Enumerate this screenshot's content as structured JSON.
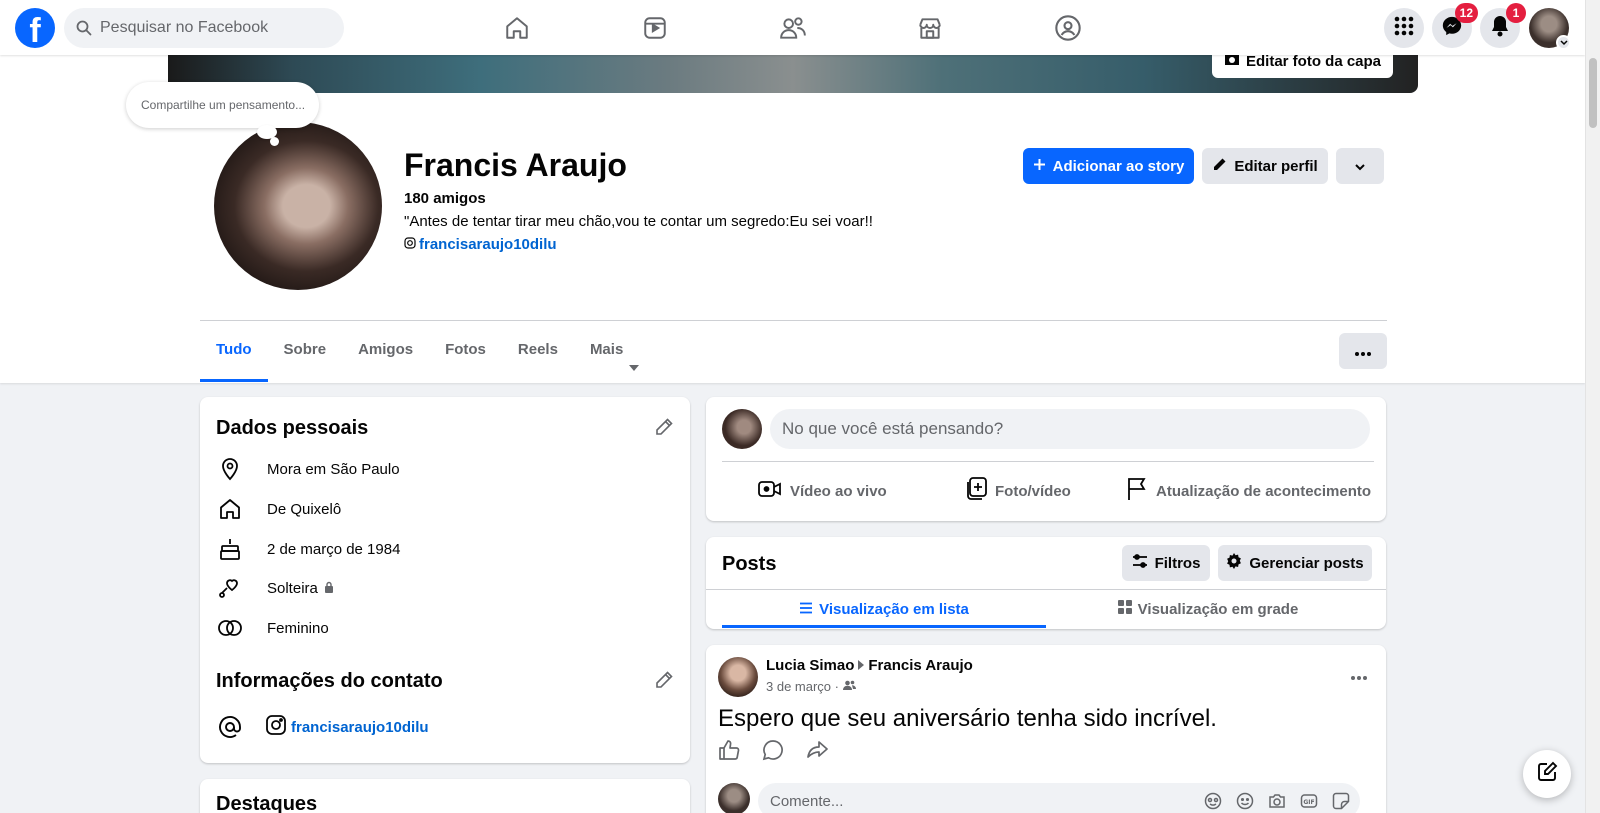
{
  "header": {
    "logo_letter": "f",
    "search_placeholder": "Pesquisar no Facebook",
    "nav_icons": [
      "home-icon",
      "video-icon",
      "friends-icon",
      "marketplace-icon",
      "groups-icon"
    ],
    "messenger_badge": "12",
    "notifications_badge": "1"
  },
  "cover": {
    "edit_label": "Editar foto da capa"
  },
  "thought_bubble": "Compartilhe um pensamento...",
  "profile": {
    "name": "Francis Araujo",
    "friends": "180 amigos",
    "bio": "\"Antes de tentar tirar meu chão,vou te contar um segredo:Eu sei voar!!",
    "instagram": "francisaraujo10dilu",
    "add_story_label": "Adicionar ao story",
    "edit_profile_label": "Editar perfil"
  },
  "tabs": [
    {
      "label": "Tudo",
      "active": true
    },
    {
      "label": "Sobre"
    },
    {
      "label": "Amigos"
    },
    {
      "label": "Fotos"
    },
    {
      "label": "Reels"
    },
    {
      "label": "Mais"
    }
  ],
  "personal": {
    "title": "Dados pessoais",
    "rows": [
      {
        "icon": "location-icon",
        "text": "Mora em São Paulo"
      },
      {
        "icon": "home-icon",
        "text": "De Quixelô"
      },
      {
        "icon": "cake-icon",
        "text": "2 de março de 1984"
      },
      {
        "icon": "relationship-icon",
        "text": "Solteira"
      },
      {
        "icon": "gender-icon",
        "text": "Feminino"
      }
    ]
  },
  "contact": {
    "title": "Informações do contato",
    "instagram": "francisaraujo10dilu"
  },
  "highlights": {
    "title": "Destaques"
  },
  "composer": {
    "placeholder": "No que você está pensando?",
    "live_label": "Vídeo ao vivo",
    "photo_label": "Foto/vídeo",
    "event_label": "Atualização de acontecimento"
  },
  "posts": {
    "title": "Posts",
    "filters_label": "Filtros",
    "manage_label": "Gerenciar posts",
    "list_view_label": "Visualização em lista",
    "grid_view_label": "Visualização em grade"
  },
  "post": {
    "author": "Lucia Simao",
    "target": "Francis Araujo",
    "date": "3 de março ·",
    "text": "Espero que seu aniversário tenha sido incrível.",
    "comment_placeholder": "Comente..."
  },
  "colors": {
    "brand_blue": "#0866ff",
    "badge_red": "#e41e3f",
    "page_bg": "#f0f2f5"
  }
}
